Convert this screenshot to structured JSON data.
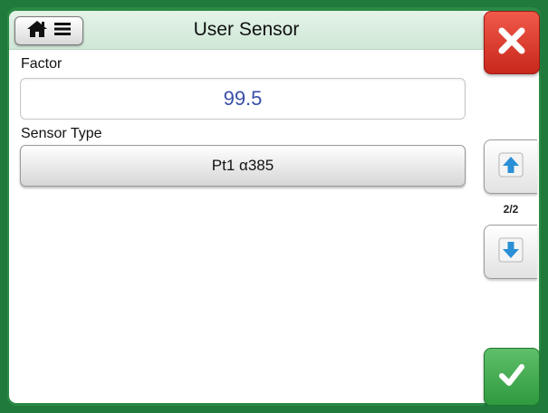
{
  "header": {
    "title": "User Sensor"
  },
  "factor": {
    "label": "Factor",
    "value": "99.5"
  },
  "sensor_type": {
    "label": "Sensor Type",
    "value": "Pt1 α385"
  },
  "sidebar": {
    "page_indicator": "2/2"
  },
  "icons": {
    "home": "home-icon",
    "menu": "menu-icon",
    "close": "close-icon",
    "page_up": "arrow-up-icon",
    "page_down": "arrow-down-icon",
    "accept": "checkmark-icon"
  },
  "colors": {
    "frame": "#1f7a3c",
    "title_bar": "#d9eddf",
    "value_text": "#3a4fa8",
    "close": "#d8362a",
    "accept": "#3fa84c",
    "arrow": "#2a8fd6"
  }
}
